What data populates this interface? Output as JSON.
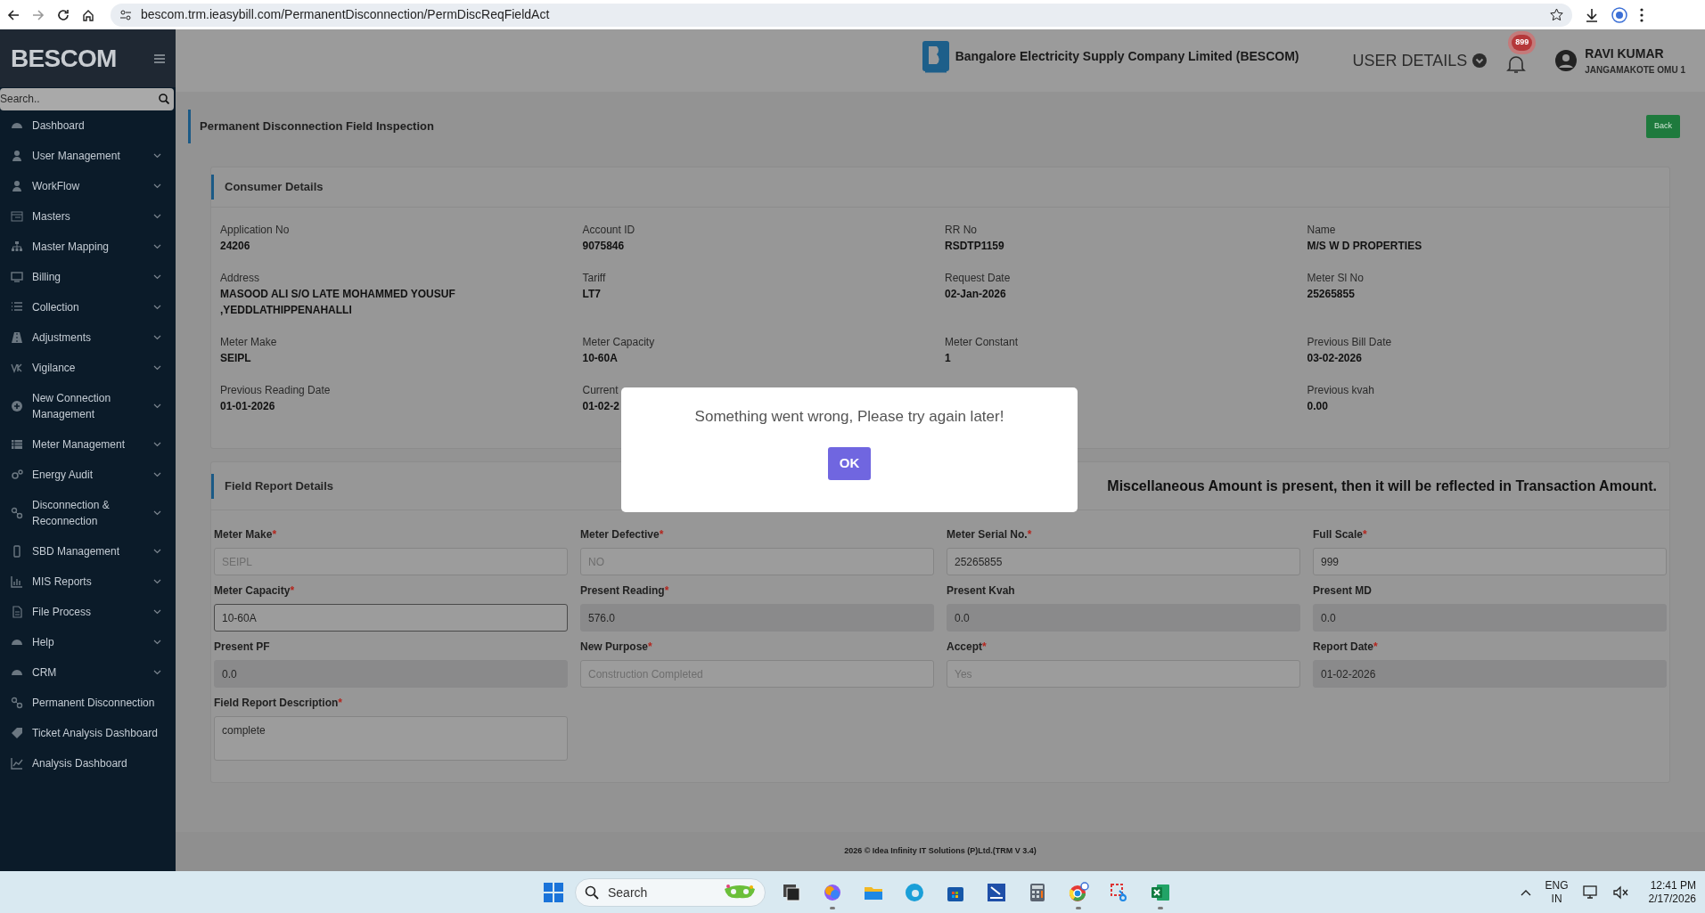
{
  "browser": {
    "url": "bescom.trm.ieasybill.com/PermanentDisconnection/PermDiscReqFieldAct"
  },
  "sidebar": {
    "brand": "BESCOM",
    "search": {
      "placeholder": "Search.."
    },
    "items": [
      {
        "label": "Dashboard",
        "expandable": false
      },
      {
        "label": "User Management",
        "expandable": true
      },
      {
        "label": "WorkFlow",
        "expandable": true
      },
      {
        "label": "Masters",
        "expandable": true
      },
      {
        "label": "Master Mapping",
        "expandable": true
      },
      {
        "label": "Billing",
        "expandable": true
      },
      {
        "label": "Collection",
        "expandable": true
      },
      {
        "label": "Adjustments",
        "expandable": true
      },
      {
        "label": "Vigilance",
        "expandable": true
      },
      {
        "label": "New Connection Management",
        "expandable": true
      },
      {
        "label": "Meter Management",
        "expandable": true
      },
      {
        "label": "Energy Audit",
        "expandable": true
      },
      {
        "label": "Disconnection & Reconnection",
        "expandable": true
      },
      {
        "label": "SBD Management",
        "expandable": true
      },
      {
        "label": "MIS Reports",
        "expandable": true
      },
      {
        "label": "File Process",
        "expandable": true
      },
      {
        "label": "Help",
        "expandable": true
      },
      {
        "label": "CRM",
        "expandable": true
      },
      {
        "label": "Permanent Disconnection",
        "expandable": false
      },
      {
        "label": "Ticket Analysis Dashboard",
        "expandable": false
      },
      {
        "label": "Analysis Dashboard",
        "expandable": false
      }
    ]
  },
  "header": {
    "company": "Bangalore Electricity Supply Company Limited (BESCOM)",
    "user_details": "USER DETAILS",
    "notifications": "899",
    "user_name": "RAVI KUMAR",
    "user_location": "JANGAMAKOTE OMU 1"
  },
  "page": {
    "title": "Permanent Disconnection Field Inspection",
    "back_button": "Back"
  },
  "consumer_details": {
    "title": "Consumer Details",
    "rows": [
      [
        {
          "label": "Application No",
          "value": "24206"
        },
        {
          "label": "Account ID",
          "value": "9075846"
        },
        {
          "label": "RR No",
          "value": "RSDTP1159"
        },
        {
          "label": "Name",
          "value": "M/S W D PROPERTIES"
        }
      ],
      [
        {
          "label": "Address",
          "value": "MASOOD ALI S/O LATE MOHAMMED YOUSUF ,YEDDLATHIPPENAHALLI"
        },
        {
          "label": "Tariff",
          "value": "LT7"
        },
        {
          "label": "Request Date",
          "value": "02-Jan-2026"
        },
        {
          "label": "Meter Sl No",
          "value": "25265855"
        }
      ],
      [
        {
          "label": "Meter Make",
          "value": "SEIPL"
        },
        {
          "label": "Meter Capacity",
          "value": "10-60A"
        },
        {
          "label": "Meter Constant",
          "value": "1"
        },
        {
          "label": "Previous Bill Date",
          "value": "03-02-2026"
        }
      ],
      [
        {
          "label": "Previous Reading Date",
          "value": "01-01-2026"
        },
        {
          "label": "Current",
          "value": "01-02-2"
        },
        "",
        {
          "label": "Previous kvah",
          "value": "0.00"
        }
      ]
    ]
  },
  "field_report": {
    "title": "Field Report Details",
    "notice": "Miscellaneous Amount is present, then it will be reflected in Transaction Amount.",
    "fields": [
      {
        "kind": "input",
        "label": "Meter Make",
        "required_mark": "*",
        "value": "SEIPL",
        "disabled": true,
        "readonly": false,
        "focused": false
      },
      {
        "kind": "input",
        "label": "Meter Defective",
        "required_mark": "*",
        "value": "NO",
        "disabled": true,
        "readonly": false,
        "focused": false
      },
      {
        "kind": "input",
        "label": "Meter Serial No.",
        "required_mark": "*",
        "value": "25265855",
        "disabled": false,
        "readonly": false,
        "focused": false
      },
      {
        "kind": "input",
        "label": "Full Scale",
        "required_mark": "*",
        "value": "999",
        "disabled": false,
        "readonly": false,
        "focused": false
      },
      {
        "kind": "input",
        "label": "Meter Capacity",
        "required_mark": "*",
        "value": "10-60A",
        "disabled": false,
        "readonly": false,
        "focused": true
      },
      {
        "kind": "input",
        "label": "Present Reading",
        "required_mark": "*",
        "value": "576.0",
        "disabled": false,
        "readonly": true,
        "focused": false
      },
      {
        "kind": "input",
        "label": "Present Kvah",
        "value": "0.0",
        "disabled": false,
        "readonly": true,
        "focused": false
      },
      {
        "kind": "input",
        "label": "Present MD",
        "value": "0.0",
        "disabled": false,
        "readonly": true,
        "focused": false
      },
      {
        "kind": "input",
        "label": "Present PF",
        "value": "0.0",
        "disabled": false,
        "readonly": true,
        "focused": false
      },
      {
        "kind": "input",
        "label": "New Purpose",
        "required_mark": "*",
        "value": "Construction Completed",
        "disabled": true,
        "readonly": false,
        "focused": false
      },
      {
        "kind": "input",
        "label": "Accept",
        "required_mark": "*",
        "value": "Yes",
        "disabled": true,
        "readonly": false,
        "focused": false
      },
      {
        "kind": "input",
        "label": "Report Date",
        "required_mark": "*",
        "value": "01-02-2026",
        "disabled": false,
        "readonly": true,
        "focused": false
      },
      {
        "kind": "textarea",
        "label": "Field Report Description",
        "required_mark": "*",
        "value": "complete",
        "disabled": false,
        "readonly": false,
        "focused": false
      }
    ]
  },
  "footer": "2026 © Idea Infinity IT Solutions (P)Ltd.(TRM V 3.4)",
  "dialog": {
    "message": "Something went wrong, Please try again later!",
    "button": "OK"
  },
  "taskbar": {
    "search": {
      "placeholder": "Search"
    },
    "apps": [
      {
        "running": false
      },
      {
        "running": true
      },
      {
        "running": false
      },
      {
        "running": false
      },
      {
        "running": false
      },
      {
        "running": false
      },
      {
        "running": false
      },
      {
        "running": true
      },
      {
        "running": false
      },
      {
        "running": true
      }
    ],
    "language": "ENG",
    "region": "IN",
    "time": "12:41 PM",
    "date": "2/17/2026"
  }
}
